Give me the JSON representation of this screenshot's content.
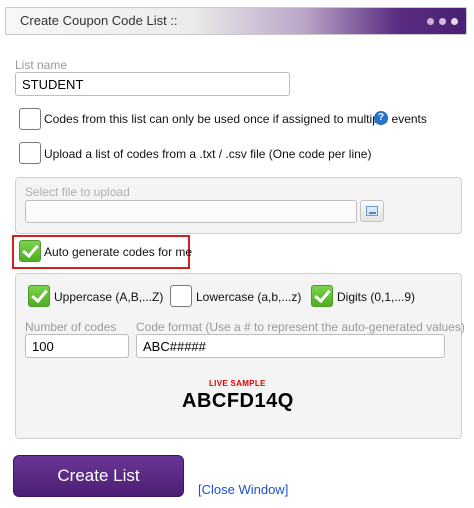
{
  "window": {
    "title": "Create Coupon Code List ::"
  },
  "list_name": {
    "label": "List name",
    "value": "STUDENT"
  },
  "options": {
    "once_only": {
      "label": "Codes from this list can only be used once if assigned to multiple events",
      "checked": false
    },
    "upload": {
      "label": "Upload a list of codes from a .txt / .csv file (One code per line)",
      "checked": false
    }
  },
  "upload_panel": {
    "label": "Select file to upload",
    "value": ""
  },
  "auto_generate": {
    "label": "Auto generate codes for me",
    "checked": true
  },
  "generate_panel": {
    "uppercase": {
      "label": "Uppercase (A,B,...Z)",
      "checked": true
    },
    "lowercase": {
      "label": "Lowercase (a,b,...z)",
      "checked": false
    },
    "digits": {
      "label": "Digits (0,1,...9)",
      "checked": true
    },
    "number_of_codes": {
      "label": "Number of codes",
      "value": "100"
    },
    "code_format": {
      "label": "Code format (Use a # to represent the auto-generated values)",
      "value": "ABC#####"
    },
    "live_sample_label": "LIVE SAMPLE",
    "live_sample_value": "ABCFD14Q"
  },
  "actions": {
    "create_label": "Create List",
    "close_label": "[Close Window]"
  },
  "colors": {
    "accent": "#4c1f74",
    "check_green": "#4fae22",
    "highlight_red": "#d21f1f",
    "link_blue": "#1d4ed8"
  },
  "icons": {
    "help": "help-icon",
    "browse": "file-browse-icon",
    "check": "checkmark-icon"
  }
}
